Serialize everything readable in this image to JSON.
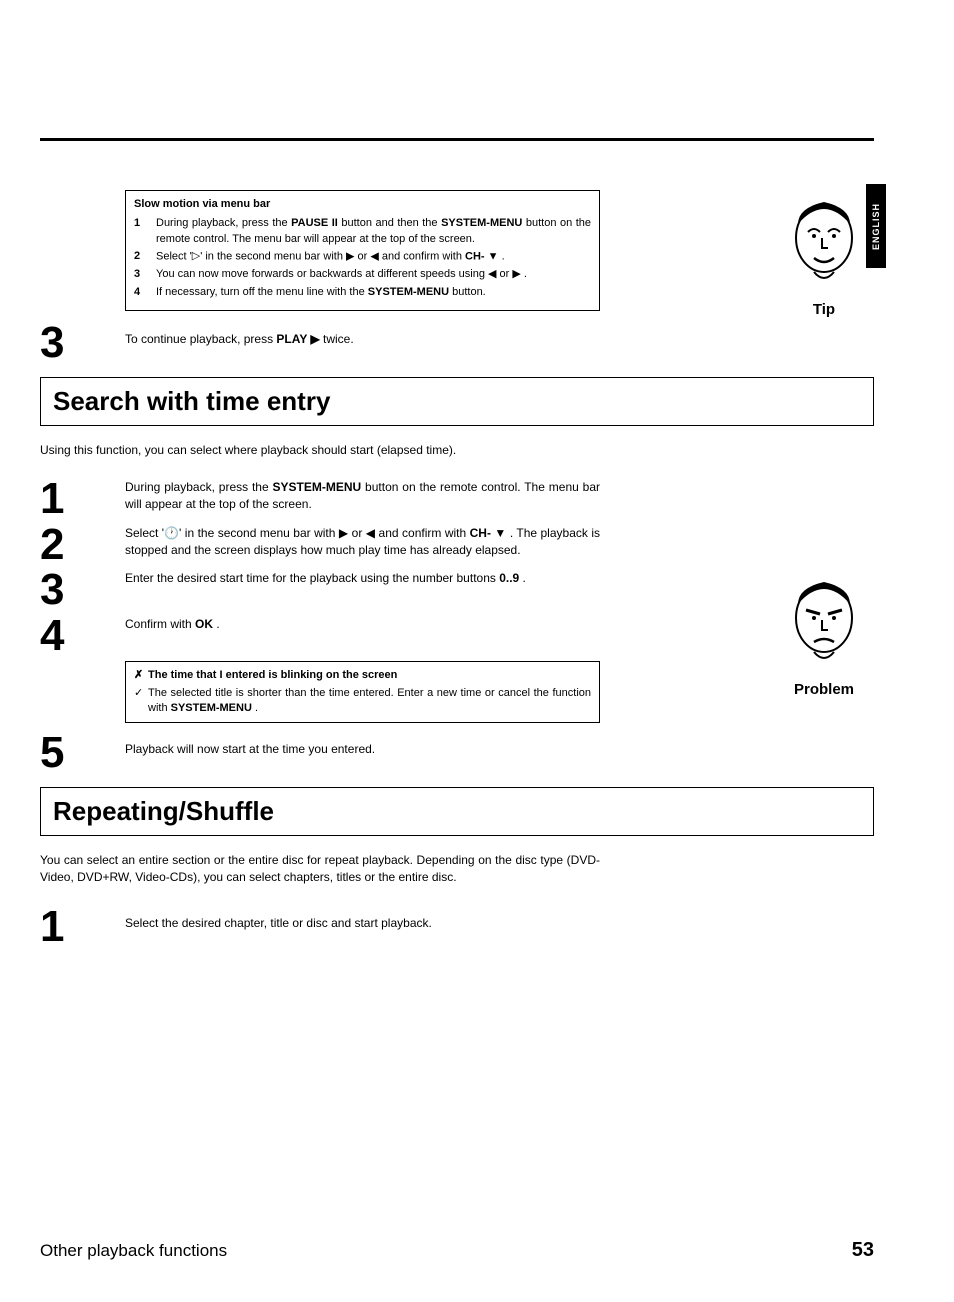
{
  "language_tab": "ENGLISH",
  "tipbox": {
    "title": "Slow motion via menu bar",
    "step1a": "During playback, press the ",
    "step1_btn1": "PAUSE II",
    "step1b": " button and then the ",
    "step1_btn2": "SYSTEM-MENU",
    "step1c": " button on the remote control. The menu bar will appear at the top of the screen.",
    "step2a": "Select '",
    "step2b": "' in the second menu bar with ▶ or ◀ and confirm with ",
    "step2_btn": "CH- ▼",
    "step2c": " .",
    "step3": "You can now move forwards or backwards at different speeds using ◀ or ▶ .",
    "step4a": "If necessary, turn off the menu line with the ",
    "step4_btn": "SYSTEM-MENU",
    "step4b": " button."
  },
  "tip_caption": "Tip",
  "step3_top_a": "To continue playback, press ",
  "step3_top_btn": "PLAY ▶",
  "step3_top_b": " twice.",
  "section1_title": "Search with time entry",
  "section1_intro": "Using this function, you can select where playback should start (elapsed time).",
  "s1_step1a": "During playback, press the ",
  "s1_step1_btn": "SYSTEM-MENU",
  "s1_step1b": " button on the remote control. The menu bar will appear at the top of the screen.",
  "s1_step2a": "Select '",
  "s1_step2b": "' in the second menu bar with ▶ or ◀ and confirm with ",
  "s1_step2_btn": "CH- ▼",
  "s1_step2c": " . The playback is stopped and the screen displays how much play time has already elapsed.",
  "s1_step3a": "Enter the desired start time for the playback using the number buttons ",
  "s1_step3_btn": "0..9",
  "s1_step3b": " .",
  "s1_step4a": "Confirm with ",
  "s1_step4_btn": "OK",
  "s1_step4b": " .",
  "problem_caption": "Problem",
  "prob_title": "The time that I entered is blinking on the screen",
  "prob_answer_a": "The selected title is shorter than the time entered. Enter a new time or cancel the function with ",
  "prob_answer_btn": "SYSTEM-MENU",
  "prob_answer_b": " .",
  "s1_step5": "Playback will now start at the time you entered.",
  "section2_title": "Repeating/Shuffle",
  "section2_intro": "You can select an entire section or the entire disc for repeat playback. Depending on the disc type (DVD-Video, DVD+RW, Video-CDs), you can select chapters, titles or the entire disc.",
  "s2_step1": "Select the desired chapter, title or disc and start playback.",
  "footer_title": "Other playback functions",
  "footer_page": "53",
  "nums": {
    "n1": "1",
    "n2": "2",
    "n3": "3",
    "n4": "4",
    "n5": "5"
  }
}
